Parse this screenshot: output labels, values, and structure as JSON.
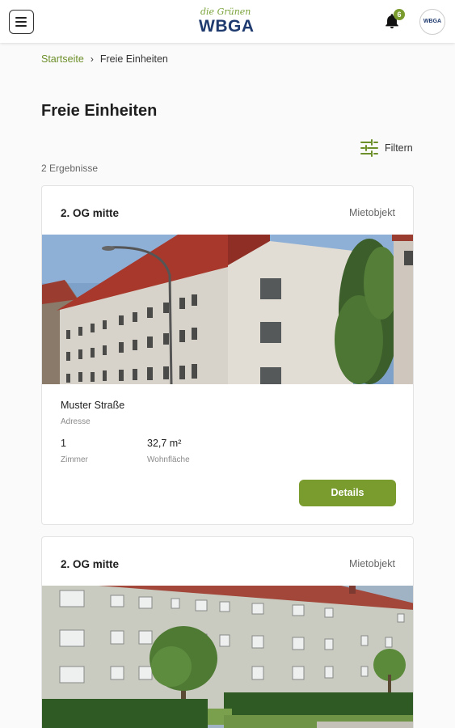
{
  "header": {
    "logo_script": "die Grünen",
    "logo_word": "WBGA",
    "notification_count": "6",
    "avatar_text": "WBGA",
    "icons": {
      "menu": "hamburger-icon",
      "notifications": "bell-icon"
    }
  },
  "breadcrumb": {
    "home": "Startseite",
    "separator": "›",
    "current": "Freie Einheiten"
  },
  "page": {
    "title": "Freie Einheiten",
    "filter_label": "Filtern",
    "results_count": "2 Ergebnisse"
  },
  "colors": {
    "accent": "#7a9b2e",
    "brand_blue": "#1f3a6e",
    "link": "#6d8f2a"
  },
  "listings": [
    {
      "title": "2. OG mitte",
      "type": "Mietobjekt",
      "address": "Muster Straße",
      "address_label": "Adresse",
      "rooms": "1",
      "rooms_label": "Zimmer",
      "area": "32,7 m²",
      "area_label": "Wohnfläche",
      "button_label": "Details"
    },
    {
      "title": "2. OG mitte",
      "type": "Mietobjekt"
    }
  ]
}
